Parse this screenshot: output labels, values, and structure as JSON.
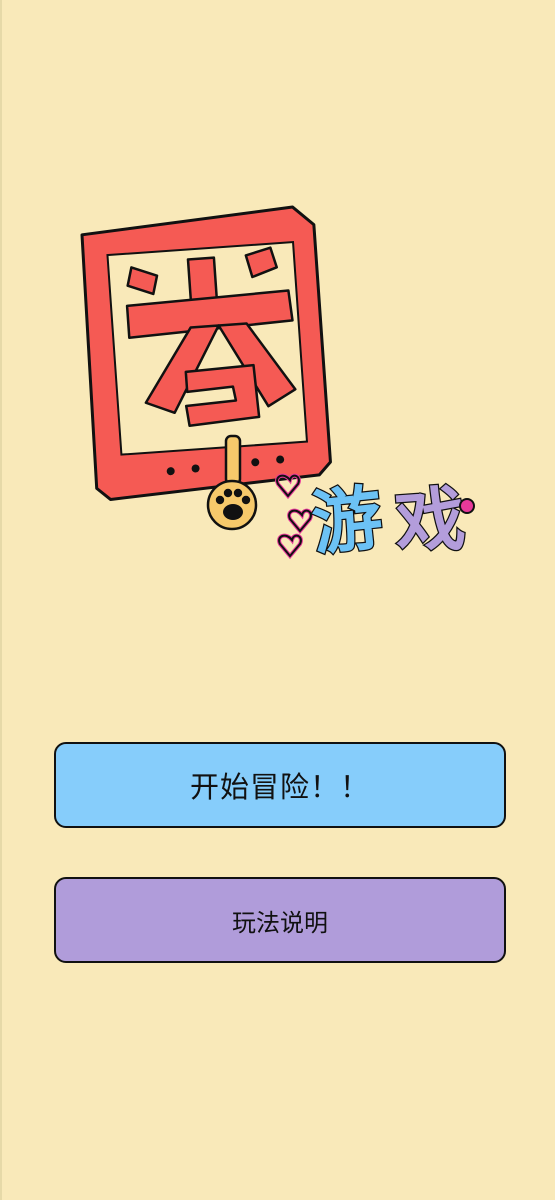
{
  "logo": {
    "main_char": "圈",
    "subtitle": "游戏",
    "colors": {
      "frame_red": "#f55a54",
      "blue_text": "#6cc2f5",
      "purple_text": "#b39ddb",
      "pink": "#e8399a",
      "paw_yellow": "#f6c96b"
    },
    "icons": [
      "paw-icon",
      "heart-chain-icon"
    ]
  },
  "buttons": {
    "start_label": "开始冒险！！",
    "help_label": "玩法说明"
  },
  "colors": {
    "background": "#f9e9b9",
    "start_button": "#86cdfb",
    "help_button": "#b09cda"
  }
}
